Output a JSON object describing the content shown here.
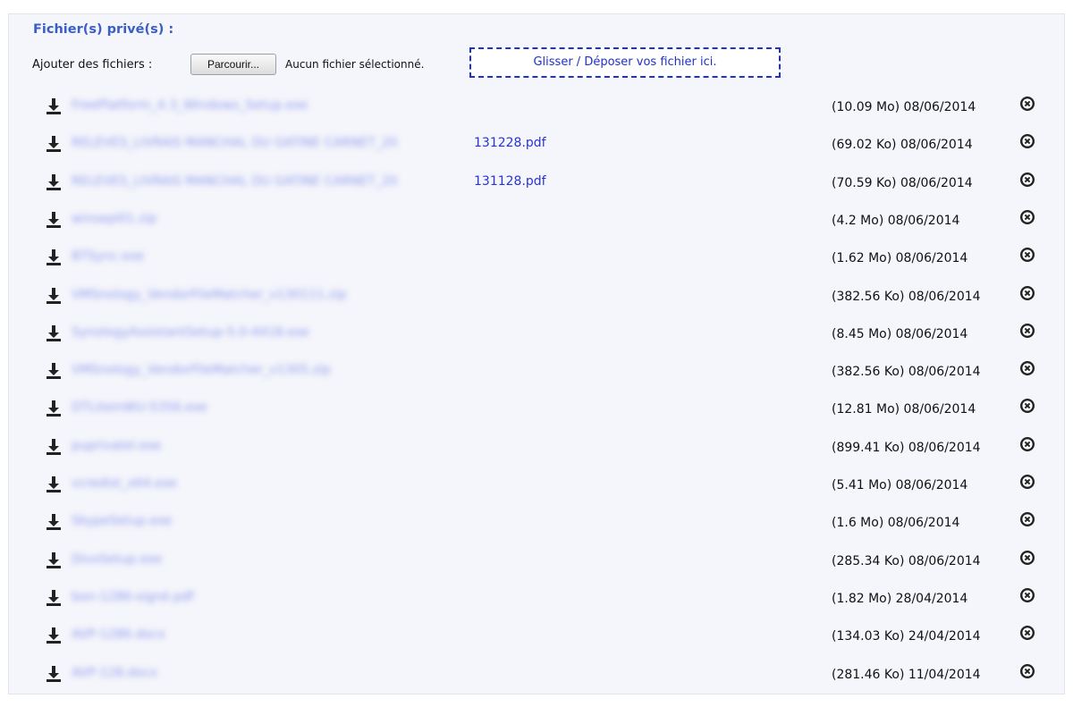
{
  "section": {
    "title": "Fichier(s) privé(s) :"
  },
  "upload": {
    "add_label": "Ajouter des fichiers :",
    "browse_label": "Parcourir...",
    "status": "Aucun fichier sélectionné.",
    "dropzone_label": "Glisser / Déposer vos fichier ici."
  },
  "files": [
    {
      "name": "FreePlatform_4.3_Windows_Setup.exe",
      "visible_suffix": "",
      "meta": "(10.09 Mo) 08/06/2014"
    },
    {
      "name": "RELEVES_LIVRAIS MANCHAL DU GATINE CARNET_20",
      "visible_suffix": "131228.pdf",
      "meta": "(69.02 Ko) 08/06/2014"
    },
    {
      "name": "RELEVES_LIVRAIS MANCHAL DU GATINE CARNET_20",
      "visible_suffix": "131128.pdf",
      "meta": "(70.59 Ko) 08/06/2014"
    },
    {
      "name": "winsepl01.zip",
      "visible_suffix": "",
      "meta": "(4.2 Mo) 08/06/2014"
    },
    {
      "name": "BTSync.exe",
      "visible_suffix": "",
      "meta": "(1.62 Mo) 08/06/2014"
    },
    {
      "name": "VMSnology_VendorFileMatcher_v130111.zip",
      "visible_suffix": "",
      "meta": "(382.56 Ko) 08/06/2014"
    },
    {
      "name": "SynologyAssistantSetup-5.0-4418.exe",
      "visible_suffix": "",
      "meta": "(8.45 Mo) 08/06/2014"
    },
    {
      "name": "VMSnology_VendorFileMatcher_v1305.zip",
      "visible_suffix": "",
      "meta": "(382.56 Ko) 08/06/2014"
    },
    {
      "name": "DTLiteinWU-5356.exe",
      "visible_suffix": "",
      "meta": "(12.81 Mo) 08/06/2014"
    },
    {
      "name": "puprivatel.exe",
      "visible_suffix": "",
      "meta": "(899.41 Ko) 08/06/2014"
    },
    {
      "name": "vcredist_x64.exe",
      "visible_suffix": "",
      "meta": "(5.41 Mo) 08/06/2014"
    },
    {
      "name": "SkypeSetup.exe",
      "visible_suffix": "",
      "meta": "(1.6 Mo) 08/06/2014"
    },
    {
      "name": "DivxSetup.exe",
      "visible_suffix": "",
      "meta": "(285.34 Ko) 08/06/2014"
    },
    {
      "name": "bon-1286-signé.pdf",
      "visible_suffix": "",
      "meta": "(1.82 Mo) 28/04/2014"
    },
    {
      "name": "AVP-1286.docx",
      "visible_suffix": "",
      "meta": "(134.03 Ko) 24/04/2014"
    },
    {
      "name": "AVP-128.docx",
      "visible_suffix": "",
      "meta": "(281.46 Ko) 11/04/2014"
    }
  ],
  "colors": {
    "accent": "#3a5dc8",
    "link": "#2833d6",
    "dropzone": "#2030c8",
    "panel_bg": "#f5f6fb"
  },
  "icons": {
    "download": "download-icon",
    "delete": "close-circle-icon"
  }
}
